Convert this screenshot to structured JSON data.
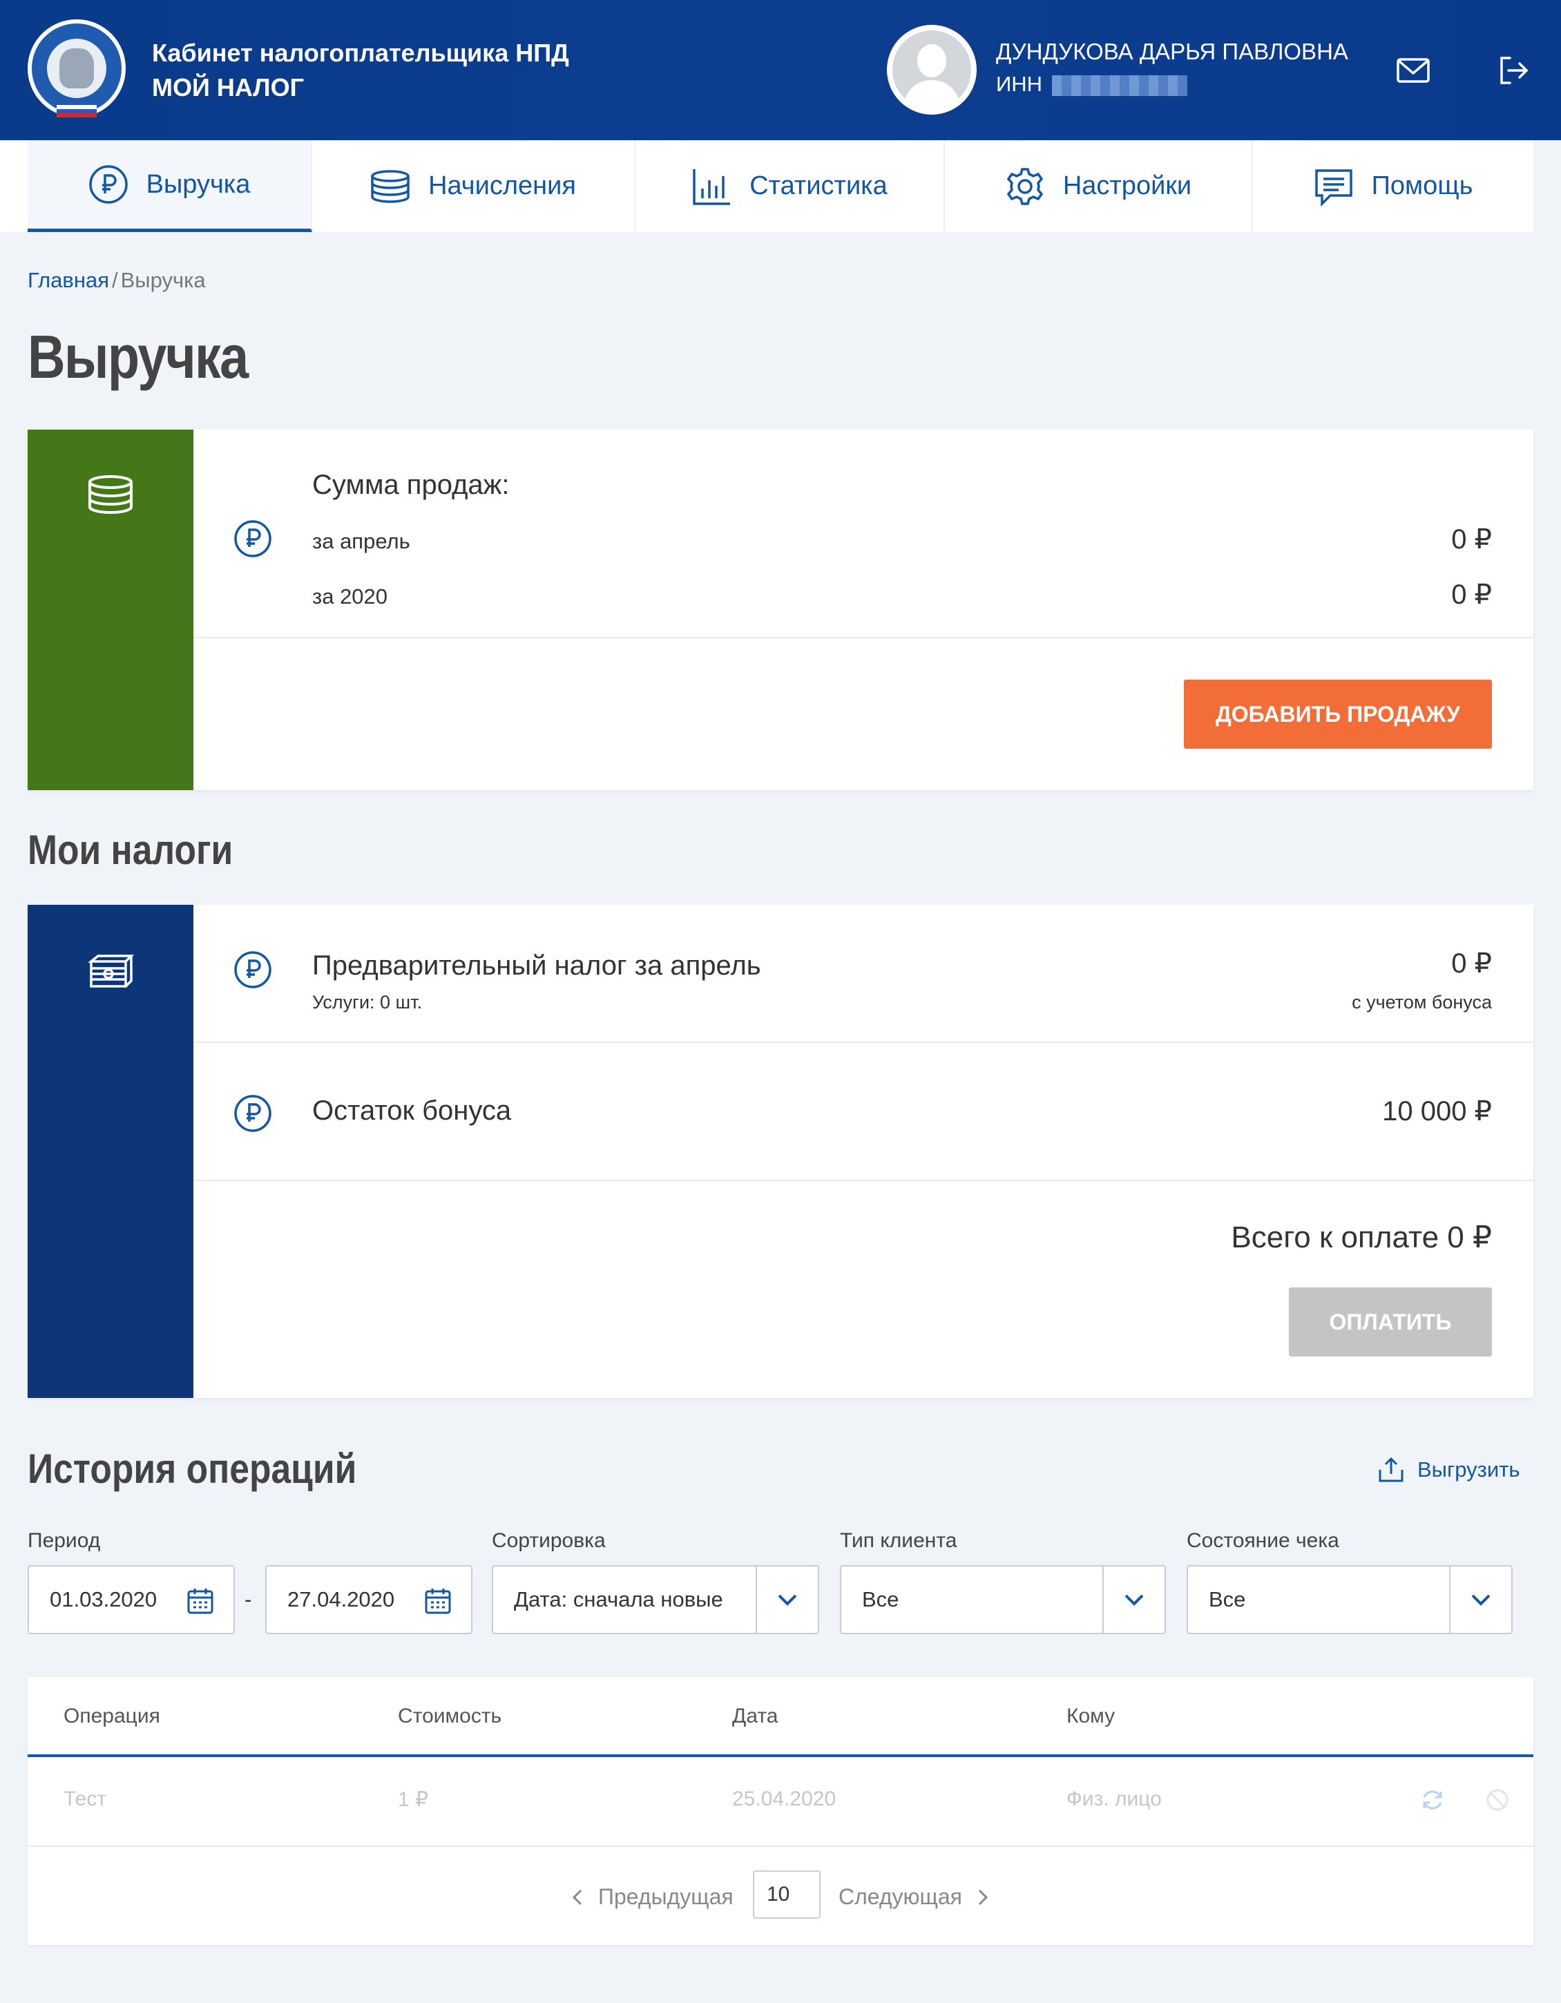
{
  "header": {
    "app_title_line1": "Кабинет налогоплательщика НПД",
    "app_title_line2": "МОЙ НАЛОГ",
    "user_name": "ДУНДУКОВА ДАРЬЯ ПАВЛОВНА",
    "inn_label": "ИНН",
    "bg_color": "#0c3e90"
  },
  "nav": {
    "items": [
      {
        "label": "Выручка",
        "icon": "ruble-circle-icon"
      },
      {
        "label": "Начисления",
        "icon": "coins-icon"
      },
      {
        "label": "Статистика",
        "icon": "bar-chart-icon"
      },
      {
        "label": "Настройки",
        "icon": "gear-icon"
      },
      {
        "label": "Помощь",
        "icon": "chat-icon"
      }
    ],
    "accent": "#1257a6"
  },
  "breadcrumb": {
    "home": "Главная",
    "sep": "/",
    "current": "Выручка"
  },
  "page_title": "Выручка",
  "sales": {
    "heading": "Сумма продаж:",
    "month_label": "за апрель",
    "month_value": "0 ₽",
    "year_label": "за 2020",
    "year_value": "0 ₽",
    "add_button": "ДОБАВИТЬ ПРОДАЖУ",
    "side_color": "#447718",
    "button_color": "#f26d38"
  },
  "taxes": {
    "section_title": "Мои налоги",
    "prelim_label": "Предварительный налог за апрель",
    "prelim_sub": "Услуги: 0 шт.",
    "prelim_value": "0 ₽",
    "prelim_note": "с учетом бонуса",
    "bonus_label": "Остаток бонуса",
    "bonus_value": "10 000 ₽",
    "total": "Всего к оплате 0 ₽",
    "pay_button": "ОПЛАТИТЬ",
    "side_color": "#0c3678"
  },
  "history": {
    "section_title": "История операций",
    "export_label": "Выгрузить",
    "filters": {
      "period_label": "Период",
      "date_from": "01.03.2020",
      "date_sep": "-",
      "date_to": "27.04.2020",
      "sort_label": "Сортировка",
      "sort_value": "Дата: сначала новые",
      "client_label": "Тип клиента",
      "client_value": "Все",
      "receipt_label": "Состояние чека",
      "receipt_value": "Все"
    },
    "columns": [
      "Операция",
      "Стоимость",
      "Дата",
      "Кому"
    ],
    "rows": [
      {
        "operation": "Тест",
        "cost": "1 ₽",
        "date": "25.04.2020",
        "to": "Физ. лицо"
      }
    ],
    "pager": {
      "prev": "Предыдущая",
      "page_size": "10",
      "next": "Следующая"
    }
  }
}
